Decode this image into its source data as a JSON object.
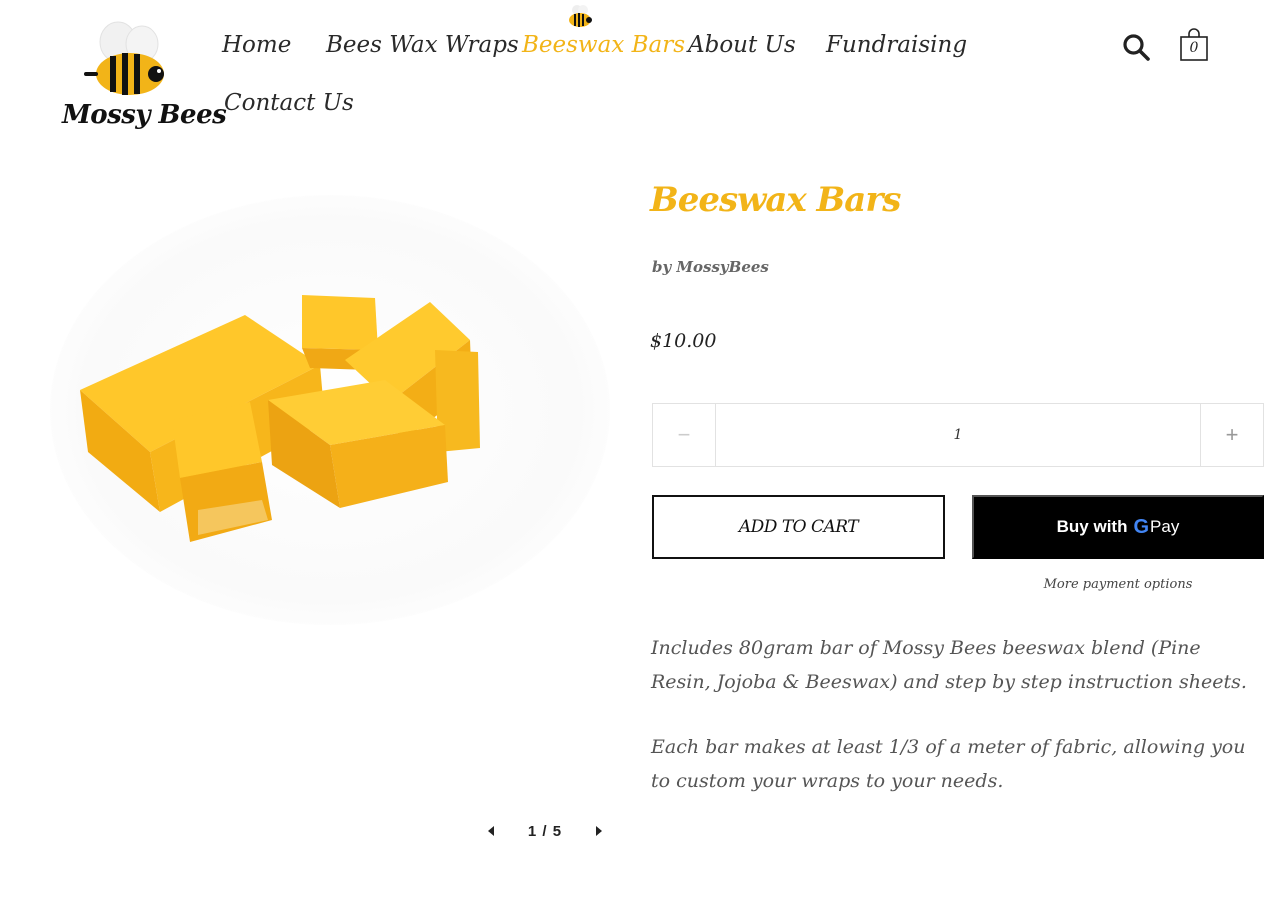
{
  "brand": {
    "name": "Mossy Bees"
  },
  "nav": {
    "items": [
      {
        "label": "Home"
      },
      {
        "label": "Bees Wax Wraps"
      },
      {
        "label": "Beeswax Bars"
      },
      {
        "label": "About Us"
      },
      {
        "label": "Fundraising"
      },
      {
        "label": "Contact Us"
      }
    ],
    "active_index": 2
  },
  "header": {
    "cart_count": "0",
    "icons": [
      "search-icon",
      "shopping-bag-icon"
    ]
  },
  "gallery": {
    "current": "1 / 5"
  },
  "product": {
    "title": "Beeswax Bars",
    "vendor": "by MossyBees",
    "price": "$10.00",
    "quantity": "1",
    "add_to_cart_label": "ADD TO CART",
    "buy_with_label": "Buy with",
    "gpay_g": "G",
    "gpay_pay": "Pay",
    "more_payment_label": "More payment options",
    "description": [
      "Includes 80gram bar of Mossy Bees beeswax blend (Pine Resin, Jojoba & Beeswax) and step by step instruction sheets.",
      "Each bar makes at least 1/3 of a meter of fabric, allowing you to custom your wraps to your needs."
    ]
  },
  "colors": {
    "accent": "#f2b418",
    "text": "#222222",
    "muted": "#555555",
    "button_dark": "#000000"
  }
}
